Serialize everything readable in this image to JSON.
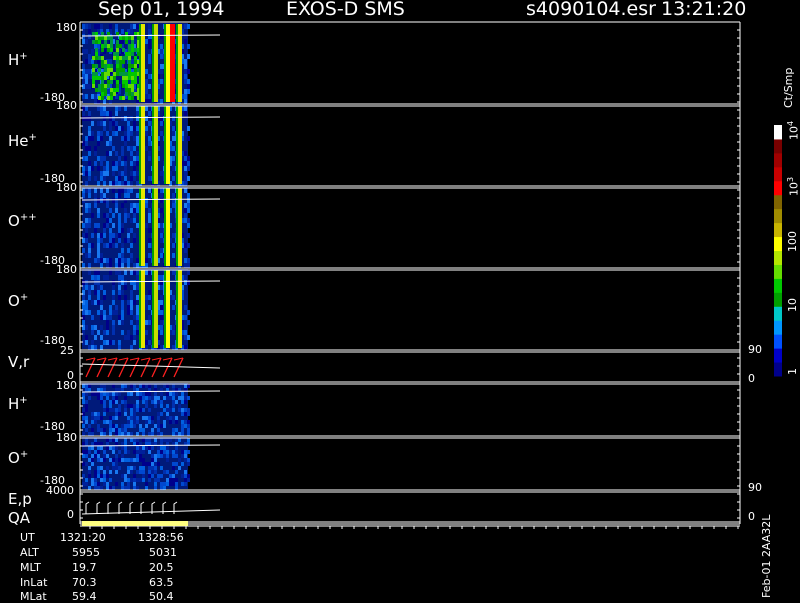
{
  "header": {
    "date": "Sep 01, 1994",
    "instrument": "EXOS-D SMS",
    "file": "s4090104.esr",
    "time": "13:21:20"
  },
  "panels": [
    {
      "label": "H",
      "sup": "+",
      "top_tick": "180",
      "bottom_tick": "-180"
    },
    {
      "label": "He",
      "sup": "+",
      "top_tick": "180",
      "bottom_tick": "-180"
    },
    {
      "label": "O",
      "sup": "++",
      "top_tick": "180",
      "bottom_tick": "-180"
    },
    {
      "label": "O",
      "sup": "+",
      "top_tick": "180",
      "bottom_tick": "-180"
    },
    {
      "label": "V,r",
      "sup": "",
      "top_tick": "25",
      "bottom_tick": "0",
      "right_top": "90",
      "right_bottom": "0"
    },
    {
      "label": "H",
      "sup": "+",
      "top_tick": "180",
      "bottom_tick": "-180"
    },
    {
      "label": "O",
      "sup": "+",
      "top_tick": "180",
      "bottom_tick": "-180"
    },
    {
      "label": "E,p",
      "sup": "",
      "top_tick": "4000",
      "bottom_tick": "0",
      "right_top": "90",
      "right_bottom": "0"
    },
    {
      "label": "QA",
      "sup": ""
    }
  ],
  "colorbar": {
    "unit": "Ct/Smp",
    "ticks": [
      "1",
      "10",
      "100",
      "10",
      "10"
    ],
    "tick_sups": [
      "",
      "",
      "",
      "3",
      "4"
    ],
    "colors": [
      "#00008b",
      "#0000c8",
      "#0050ff",
      "#0096ff",
      "#00c8c8",
      "#00a000",
      "#00c800",
      "#64dc00",
      "#b4e600",
      "#ffff00",
      "#c8b400",
      "#a08c00",
      "#806400",
      "#ff0000",
      "#c80000",
      "#a00000",
      "#780000",
      "#ffffff"
    ]
  },
  "orbit_table": {
    "rows": [
      {
        "name": "UT",
        "v1": "1321:20",
        "v2": "1328:56"
      },
      {
        "name": "ALT",
        "v1": "5955",
        "v2": "5031"
      },
      {
        "name": "MLT",
        "v1": "19.7",
        "v2": "20.5"
      },
      {
        "name": "InLat",
        "v1": "70.3",
        "v2": "63.5"
      },
      {
        "name": "MLat",
        "v1": "59.4",
        "v2": "50.4"
      }
    ]
  },
  "version_label": "Feb-01 2AA32L",
  "chart_data": {
    "type": "heatmap",
    "title": "Sep 01, 1994   EXOS-D SMS",
    "series": [
      {
        "name": "H+"
      },
      {
        "name": "He+"
      },
      {
        "name": "O++"
      },
      {
        "name": "O+"
      },
      {
        "name": "V,r"
      },
      {
        "name": "H+"
      },
      {
        "name": "O+"
      },
      {
        "name": "E,p"
      },
      {
        "name": "QA"
      }
    ],
    "ylim_pitch": [
      -180,
      180
    ],
    "ylim_vr": [
      0,
      25
    ],
    "ylim_ep": [
      0,
      4000
    ],
    "right_axis": [
      0,
      90
    ],
    "colorbar_range": [
      1,
      10000
    ],
    "colorbar_scale": "log",
    "ut_range": [
      "1321:20",
      "1328:56"
    ]
  }
}
